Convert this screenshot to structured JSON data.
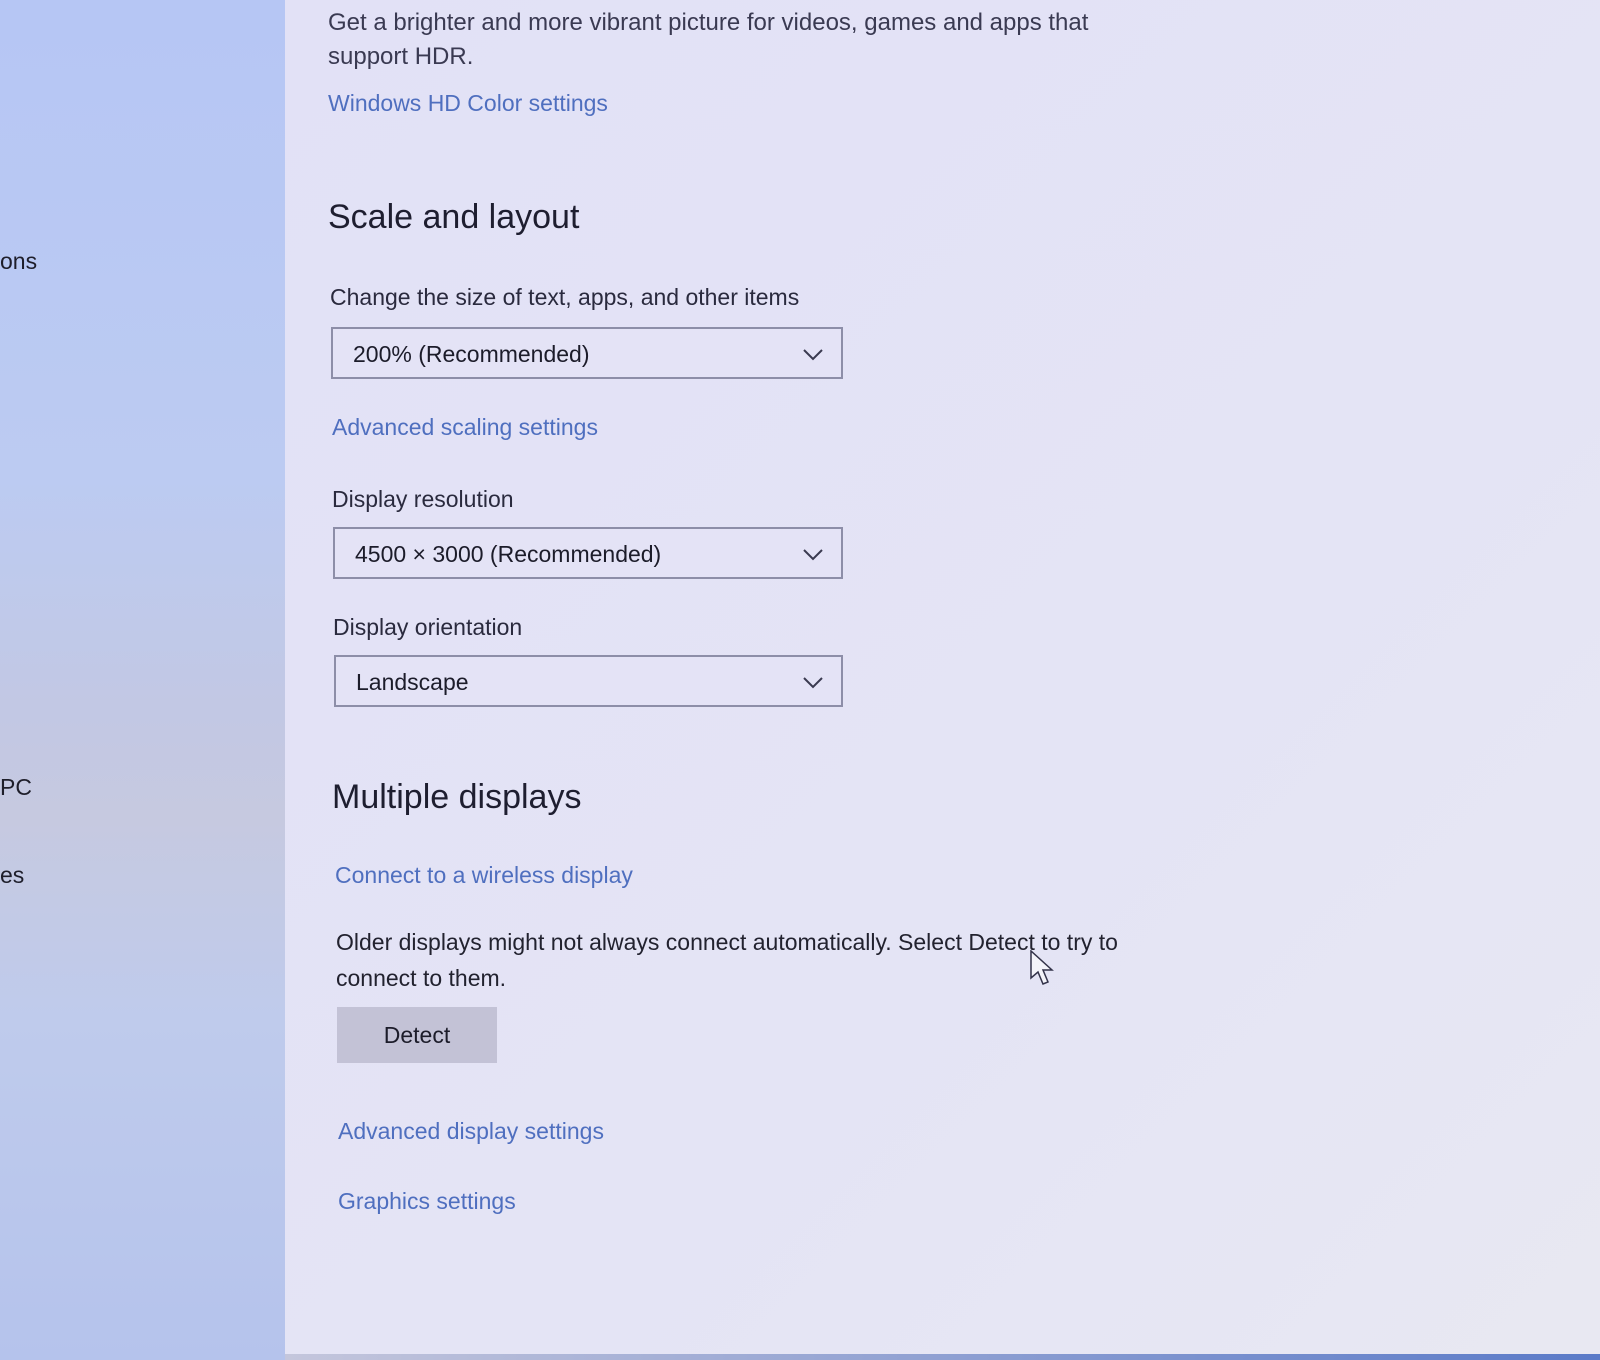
{
  "sidebar": {
    "items": [
      {
        "label": "ons"
      },
      {
        "label": "PC"
      },
      {
        "label": "es"
      }
    ]
  },
  "hdr": {
    "description": "Get a brighter and more vibrant picture for videos, games and apps that support HDR.",
    "link": "Windows HD Color settings"
  },
  "scale": {
    "heading": "Scale and layout",
    "size_label": "Change the size of text, apps, and other items",
    "size_value": "200% (Recommended)",
    "advanced_link": "Advanced scaling settings",
    "resolution_label": "Display resolution",
    "resolution_value": "4500 × 3000 (Recommended)",
    "orientation_label": "Display orientation",
    "orientation_value": "Landscape"
  },
  "multiple": {
    "heading": "Multiple displays",
    "wireless_link": "Connect to a wireless display",
    "description": "Older displays might not always connect automatically. Select Detect to try to connect to them.",
    "detect_button": "Detect",
    "advanced_display_link": "Advanced display settings",
    "graphics_link": "Graphics settings"
  },
  "colors": {
    "link": "#4f6fbf",
    "button": "#c3c2d6"
  }
}
